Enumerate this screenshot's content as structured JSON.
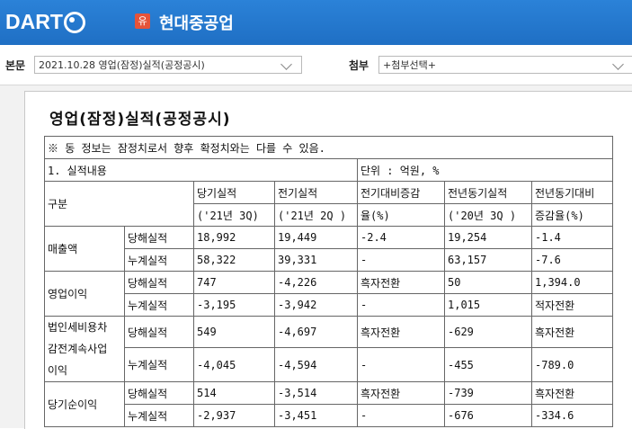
{
  "header": {
    "logo": "DART",
    "badge": "유",
    "company": "현대중공업"
  },
  "toolbar": {
    "main_label": "본문",
    "main_value": "2021.10.28  영업(잠정)실적(공정공시)",
    "attach_label": "첨부",
    "attach_value": "+첨부선택+"
  },
  "doc": {
    "title": "영업(잠정)실적(공정공시)",
    "notice": "※ 동 정보는 잠정치로서 향후 확정치와는 다를 수 있음.",
    "section": "1. 실적내용",
    "unit": "단위 : 억원, %",
    "headers": {
      "category": "구분",
      "cur_1": "당기실적",
      "cur_2": "('21년 3Q)",
      "prev_1": "전기실적",
      "prev_2": "('21년 2Q )",
      "qoq_1": "전기대비증감",
      "qoq_2": "율(%)",
      "yoy_1": "전년동기실적",
      "yoy_2": "('20년 3Q )",
      "yoyr_1": "전년동기대비",
      "yoyr_2": "증감율(%)"
    },
    "groups": [
      {
        "name": "매출액",
        "rows": [
          {
            "type": "당해실적",
            "cur": "18,992",
            "prev": "19,449",
            "qoq": "-2.4",
            "yoy": "19,254",
            "yoyr": "-1.4"
          },
          {
            "type": "누계실적",
            "cur": "58,322",
            "prev": "39,331",
            "qoq": "-",
            "yoy": "63,157",
            "yoyr": "-7.6"
          }
        ]
      },
      {
        "name": "영업이익",
        "rows": [
          {
            "type": "당해실적",
            "cur": "747",
            "prev": "-4,226",
            "qoq": "흑자전환",
            "yoy": "50",
            "yoyr": "1,394.0"
          },
          {
            "type": "누계실적",
            "cur": "-3,195",
            "prev": "-3,942",
            "qoq": "-",
            "yoy": "1,015",
            "yoyr": "적자전환"
          }
        ]
      },
      {
        "name_lines": [
          "법인세비용차",
          "감전계속사업",
          "이익"
        ],
        "rows": [
          {
            "type": "당해실적",
            "cur": "549",
            "prev": "-4,697",
            "qoq": "흑자전환",
            "yoy": "-629",
            "yoyr": "흑자전환"
          },
          {
            "type": "누계실적",
            "cur": "-4,045",
            "prev": "-4,594",
            "qoq": "-",
            "yoy": "-455",
            "yoyr": "-789.0"
          }
        ]
      },
      {
        "name": "당기순이익",
        "rows": [
          {
            "type": "당해실적",
            "cur": "514",
            "prev": "-3,514",
            "qoq": "흑자전환",
            "yoy": "-739",
            "yoyr": "흑자전환"
          },
          {
            "type": "누계실적",
            "cur": "-2,937",
            "prev": "-3,451",
            "qoq": "-",
            "yoy": "-676",
            "yoyr": "-334.6"
          }
        ]
      }
    ]
  }
}
